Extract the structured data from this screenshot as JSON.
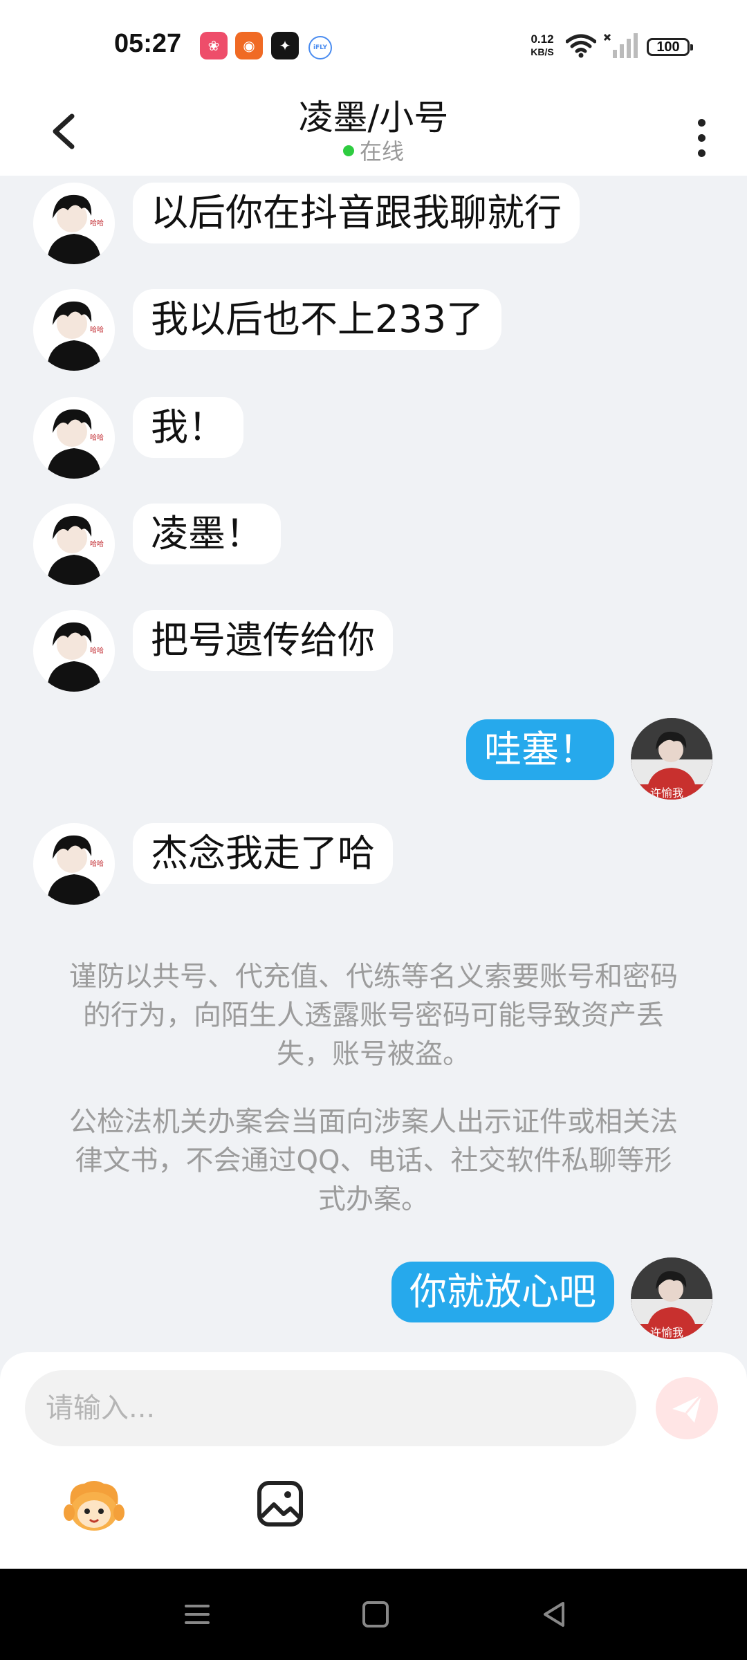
{
  "status_bar": {
    "time": "05:27",
    "app_icons": [
      {
        "name": "pink-app-icon",
        "color": "#ee4d6a",
        "glyph": "❀"
      },
      {
        "name": "orange-app-icon",
        "color": "#f06a24",
        "glyph": "◉"
      },
      {
        "name": "black-app-icon",
        "color": "#151515",
        "glyph": "✦"
      },
      {
        "name": "ifly-app-icon",
        "color": "#4a8cf0",
        "glyph": "iFLY"
      }
    ],
    "net_speed_value": "0.12",
    "net_speed_unit": "KB/S",
    "battery": "100"
  },
  "header": {
    "title": "凌墨/小号",
    "status": "在线",
    "status_color": "#2ecc40"
  },
  "messages": [
    {
      "side": "left",
      "text": "以后你在抖音跟我聊就行"
    },
    {
      "side": "left",
      "text": "我以后也不上233了"
    },
    {
      "side": "left",
      "text": "我！"
    },
    {
      "side": "left",
      "text": "凌墨！"
    },
    {
      "side": "left",
      "text": "把号遗传给你"
    },
    {
      "side": "right",
      "text": "哇塞！"
    },
    {
      "side": "left",
      "text": "杰念我走了哈"
    }
  ],
  "notices": [
    "谨防以共号、代充值、代练等名义索要账号和密码的行为，向陌生人透露账号密码可能导致资产丢失，账号被盗。",
    "公检法机关办案会当面向涉案人出示证件或相关法律文书，不会通过QQ、电话、社交软件私聊等形式办案。"
  ],
  "last_message": {
    "side": "right",
    "text": "你就放心吧"
  },
  "input": {
    "placeholder": "请输入...",
    "value": ""
  },
  "colors": {
    "accent": "#26a9ec",
    "background": "#f0f2f5",
    "send_button": "#ffe5e5"
  }
}
